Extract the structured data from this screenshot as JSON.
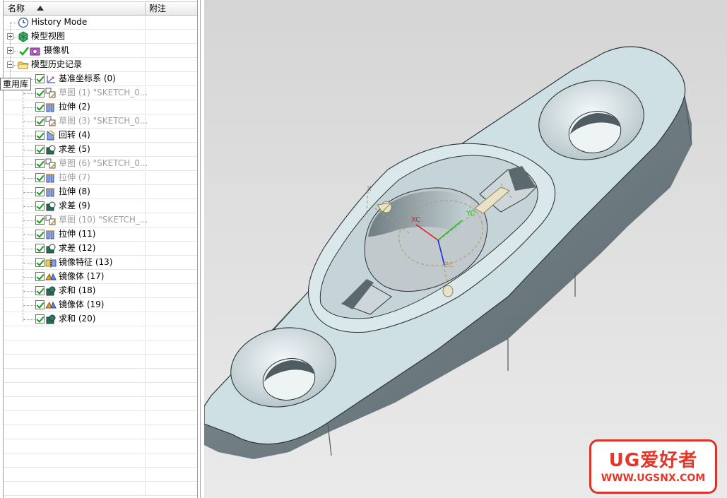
{
  "navigator": {
    "columns": {
      "name": "名称",
      "note": "附注"
    },
    "tooltip": "重用库",
    "top_nodes": [
      {
        "label": "History Mode",
        "icon": "clock-icon"
      },
      {
        "label": "模型视图",
        "icon": "model-views-icon"
      },
      {
        "label": "摄像机",
        "icon": "camera-icon"
      },
      {
        "label": "模型历史记录",
        "icon": "folder-icon"
      }
    ],
    "features": [
      {
        "label": "基准坐标系 (0)",
        "icon": "datum-csys-icon",
        "suppressed": false
      },
      {
        "label": "草图 (1) \"SKETCH_0...",
        "icon": "sketch-icon",
        "suppressed": true
      },
      {
        "label": "拉伸 (2)",
        "icon": "extrude-icon",
        "suppressed": false
      },
      {
        "label": "草图 (3) \"SKETCH_0...",
        "icon": "sketch-icon",
        "suppressed": true
      },
      {
        "label": "回转 (4)",
        "icon": "revolve-icon",
        "suppressed": false
      },
      {
        "label": "求差 (5)",
        "icon": "subtract-icon",
        "suppressed": false
      },
      {
        "label": "草图 (6) \"SKETCH_0...",
        "icon": "sketch-icon",
        "suppressed": true
      },
      {
        "label": "拉伸 (7)",
        "icon": "extrude-icon",
        "suppressed": true
      },
      {
        "label": "拉伸 (8)",
        "icon": "extrude-icon",
        "suppressed": false
      },
      {
        "label": "求差 (9)",
        "icon": "subtract-icon",
        "suppressed": false
      },
      {
        "label": "草图 (10) \"SKETCH_...",
        "icon": "sketch-icon",
        "suppressed": true
      },
      {
        "label": "拉伸 (11)",
        "icon": "extrude-icon",
        "suppressed": false
      },
      {
        "label": "求差 (12)",
        "icon": "subtract-icon",
        "suppressed": false
      },
      {
        "label": "镜像特征 (13)",
        "icon": "mirror-feature-icon",
        "suppressed": false
      },
      {
        "label": "镜像体 (17)",
        "icon": "mirror-body-icon",
        "suppressed": false
      },
      {
        "label": "求和 (18)",
        "icon": "unite-icon",
        "suppressed": false
      },
      {
        "label": "镜像体 (19)",
        "icon": "mirror-body-icon",
        "suppressed": false
      },
      {
        "label": "求和 (20)",
        "icon": "unite-icon",
        "suppressed": false
      }
    ]
  },
  "viewport": {
    "csys_labels": {
      "x": "X",
      "xc": "XC",
      "yc": "YC",
      "zc": "ZC"
    },
    "colors": {
      "part_face": "#cfe0e5",
      "part_side": "#6d7b80",
      "axis_x": "#e02020",
      "axis_y": "#20c020",
      "axis_z": "#2030e0",
      "csys_dashed": "#a89c6a"
    }
  },
  "watermark": {
    "line1": "UG爱好者",
    "line2": "WWW.UGSNX.COM",
    "color": "#e2382c"
  }
}
